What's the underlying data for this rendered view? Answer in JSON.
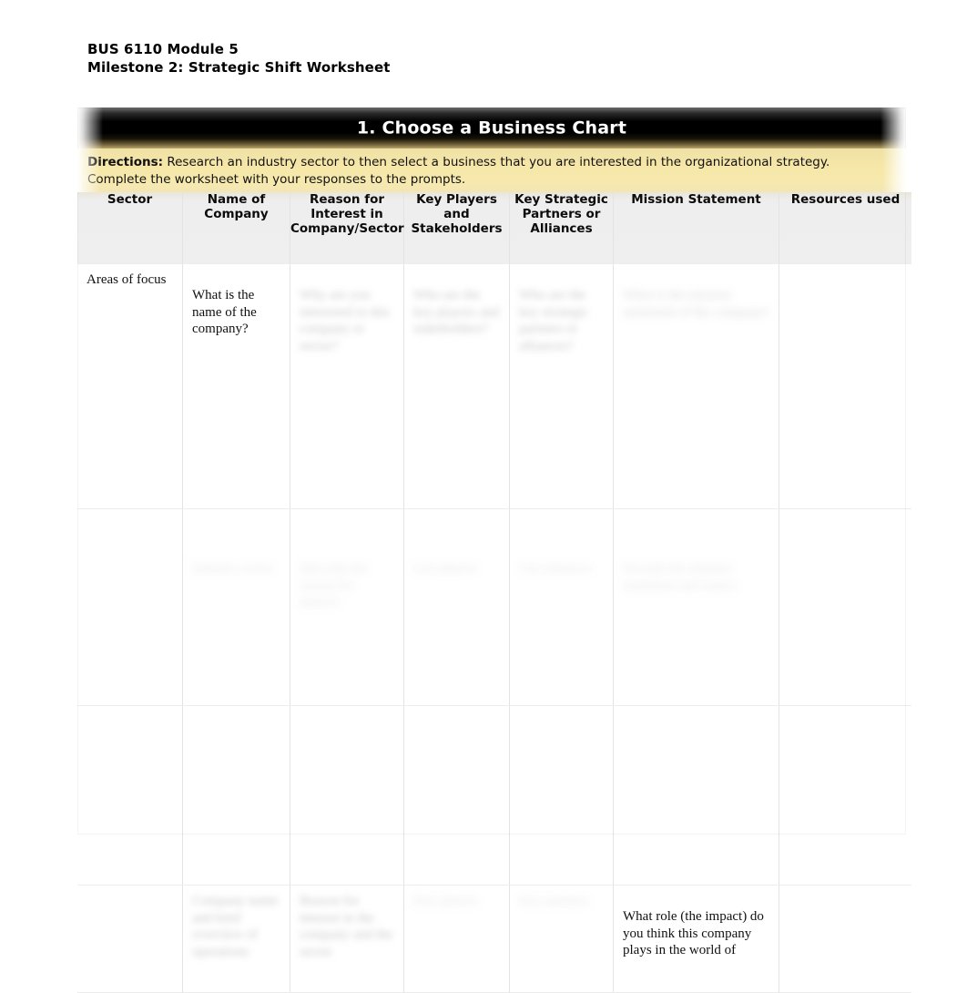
{
  "document": {
    "heading_line1": "BUS 6110 Module 5",
    "heading_line2": "Milestone 2: Strategic Shift Worksheet"
  },
  "banner": {
    "title": "1. Choose a Business Chart"
  },
  "directions": {
    "label": "Directions:",
    "text": " Research an industry sector to then select a business that you are interested in the organizational strategy. Complete the worksheet with your responses to the prompts."
  },
  "table": {
    "columns": [
      "Sector",
      "Name of Company",
      "Reason for Interest in Company/Sector",
      "Key Players and Stakeholders",
      "Key Strategic Partners or Alliances",
      "Mission Statement",
      "Resources used"
    ],
    "rows": [
      {
        "sector": "Areas of focus",
        "company": "What is the name of the company?",
        "reason": "Why are you interested in this company or sector?",
        "players": "Who are the key players and stakeholders?",
        "partners": "Who are the key strategic partners or alliances?",
        "mission": "What is the mission statement of the company?",
        "resources": ""
      },
      {
        "sector": "",
        "company": "Industry sector",
        "reason": "Describe the reason for interest",
        "players": "List players",
        "partners": "List alliances",
        "mission": "Provide the mission statement and source",
        "resources": ""
      },
      {
        "sector": "",
        "company": "",
        "reason": "",
        "players": "",
        "partners": "",
        "mission": "",
        "resources": ""
      },
      {
        "sector": "",
        "company": "Company name and brief overview of operations",
        "reason": "Reason for interest in the company and the sector",
        "players": "Key players",
        "partners": "Key partners",
        "mission": "What role (the impact) do you think this company plays in the world of",
        "resources": ""
      }
    ]
  }
}
